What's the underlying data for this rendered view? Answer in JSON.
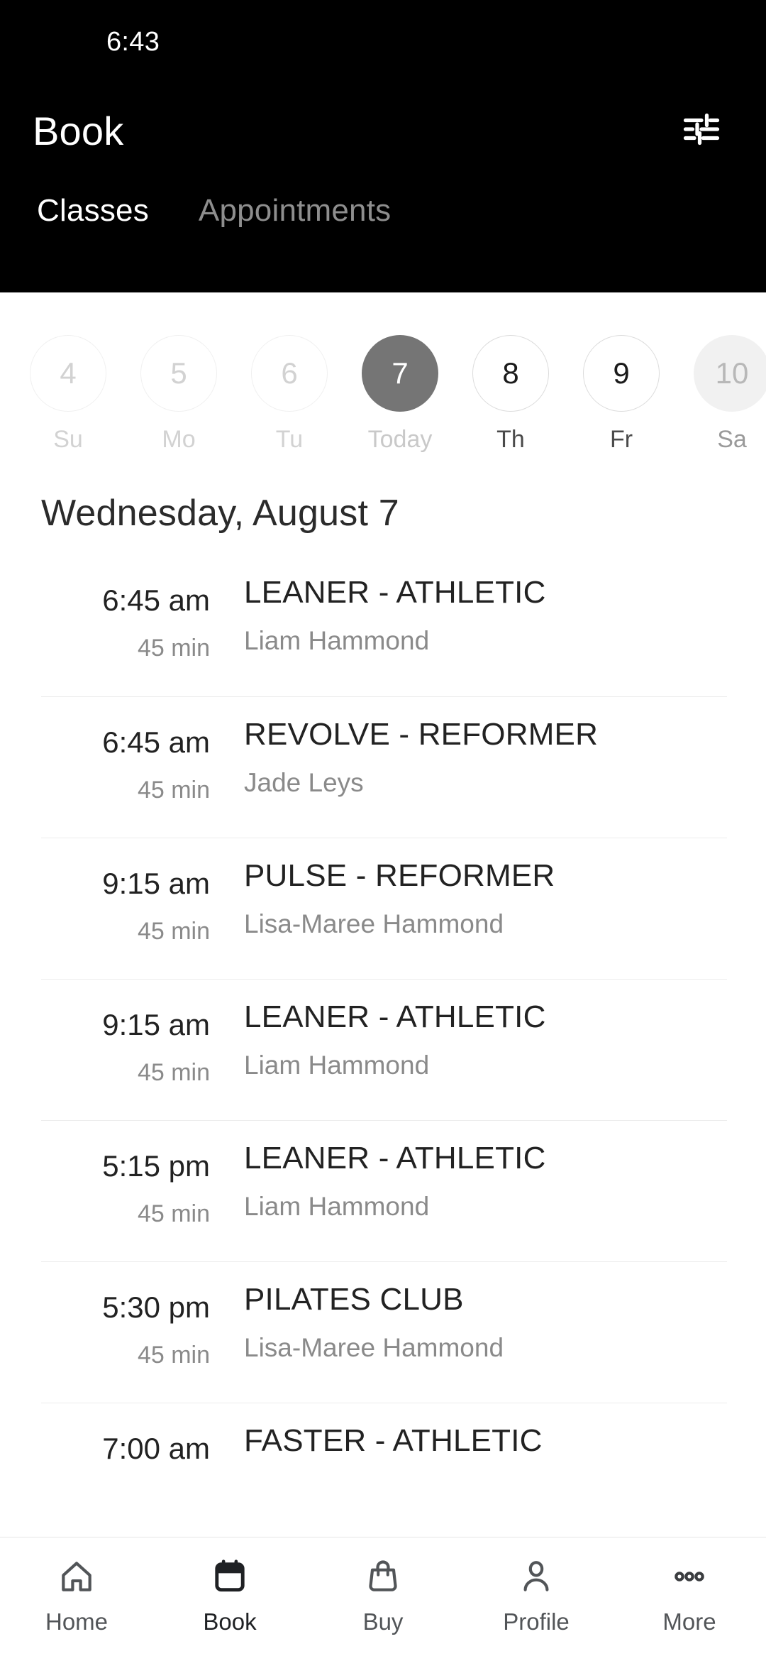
{
  "status_bar": {
    "time": "6:43"
  },
  "header": {
    "title": "Book",
    "filter_icon": "tune-filter-icon",
    "tabs": [
      {
        "label": "Classes",
        "active": true
      },
      {
        "label": "Appointments",
        "active": false
      }
    ]
  },
  "date_strip": {
    "days": [
      {
        "date": "4",
        "label": "Su",
        "state": "past"
      },
      {
        "date": "5",
        "label": "Mo",
        "state": "past"
      },
      {
        "date": "6",
        "label": "Tu",
        "state": "past"
      },
      {
        "date": "7",
        "label": "Today",
        "state": "selected"
      },
      {
        "date": "8",
        "label": "Th",
        "state": "future"
      },
      {
        "date": "9",
        "label": "Fr",
        "state": "future"
      },
      {
        "date": "10",
        "label": "Sa",
        "state": "edge"
      }
    ]
  },
  "day_heading": "Wednesday, August 7",
  "classes": [
    {
      "time": "6:45 am",
      "duration": "45 min",
      "name": "LEANER - ATHLETIC",
      "instructor": "Liam Hammond"
    },
    {
      "time": "6:45 am",
      "duration": "45 min",
      "name": "REVOLVE - REFORMER",
      "instructor": "Jade Leys"
    },
    {
      "time": "9:15 am",
      "duration": "45 min",
      "name": "PULSE - REFORMER",
      "instructor": "Lisa-Maree Hammond"
    },
    {
      "time": "9:15 am",
      "duration": "45 min",
      "name": "LEANER - ATHLETIC",
      "instructor": "Liam Hammond"
    },
    {
      "time": "5:15 pm",
      "duration": "45 min",
      "name": "LEANER - ATHLETIC",
      "instructor": "Liam Hammond"
    },
    {
      "time": "5:30 pm",
      "duration": "45 min",
      "name": "PILATES CLUB",
      "instructor": "Lisa-Maree Hammond"
    },
    {
      "time": "7:00 am",
      "duration": "",
      "name": "FASTER - ATHLETIC",
      "instructor": ""
    }
  ],
  "bottom_nav": {
    "items": [
      {
        "label": "Home",
        "icon": "home-icon",
        "active": false
      },
      {
        "label": "Book",
        "icon": "calendar-icon",
        "active": true
      },
      {
        "label": "Buy",
        "icon": "bag-icon",
        "active": false
      },
      {
        "label": "Profile",
        "icon": "person-icon",
        "active": false
      },
      {
        "label": "More",
        "icon": "ellipsis-icon",
        "active": false
      }
    ]
  },
  "colors": {
    "header_bg": "#000000",
    "selected_day": "#757575",
    "body_bg": "#ffffff",
    "primary_text": "#222222",
    "muted_text": "#8a8a8a"
  }
}
